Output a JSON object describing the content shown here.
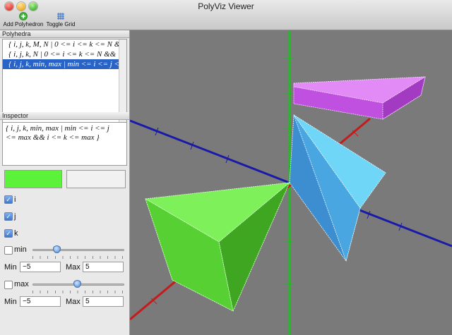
{
  "window": {
    "title": "PolyViz Viewer"
  },
  "toolbar": {
    "add_label": "Add Polyhedron",
    "grid_label": "Toggle Grid"
  },
  "polyhedra": {
    "header": "Polyhedra",
    "items": [
      "{ i, j, k, M, N | 0 <= i <= k <= N &",
      "{ i, j, k, N | 0 <= i <= k <= N &&",
      "{ i, j, k, min, max | min <= i <= j <"
    ],
    "selected_index": 2
  },
  "inspector": {
    "header": "Inspector",
    "text_line1": "{ i, j, k, min, max | min <= i <= j",
    "text_line2": "<= max && i <= k <= max }",
    "fill_color": "#5cf23a",
    "edge_color": "#f1f1f1",
    "vars": [
      {
        "label": "i",
        "checked": true
      },
      {
        "label": "j",
        "checked": true
      },
      {
        "label": "k",
        "checked": true
      }
    ],
    "min": {
      "label": "min",
      "checked": false,
      "slider_value": 0.24,
      "min_label": "Min",
      "min_value": "−5",
      "max_label": "Max",
      "max_value": "5"
    },
    "max": {
      "label": "max",
      "checked": false,
      "slider_value": 0.49,
      "min_label": "Min",
      "min_value": "−5",
      "max_label": "Max",
      "max_value": "5"
    }
  },
  "viewport": {
    "background": "#7a7a7a",
    "axis_colors": {
      "x": "#1a1aa8",
      "y": "#1fbd1f",
      "z": "#c41c1c"
    },
    "solid_colors": {
      "green": "#5cf23a",
      "cyan": "#4fc8f5",
      "magenta": "#d66cf0"
    }
  }
}
